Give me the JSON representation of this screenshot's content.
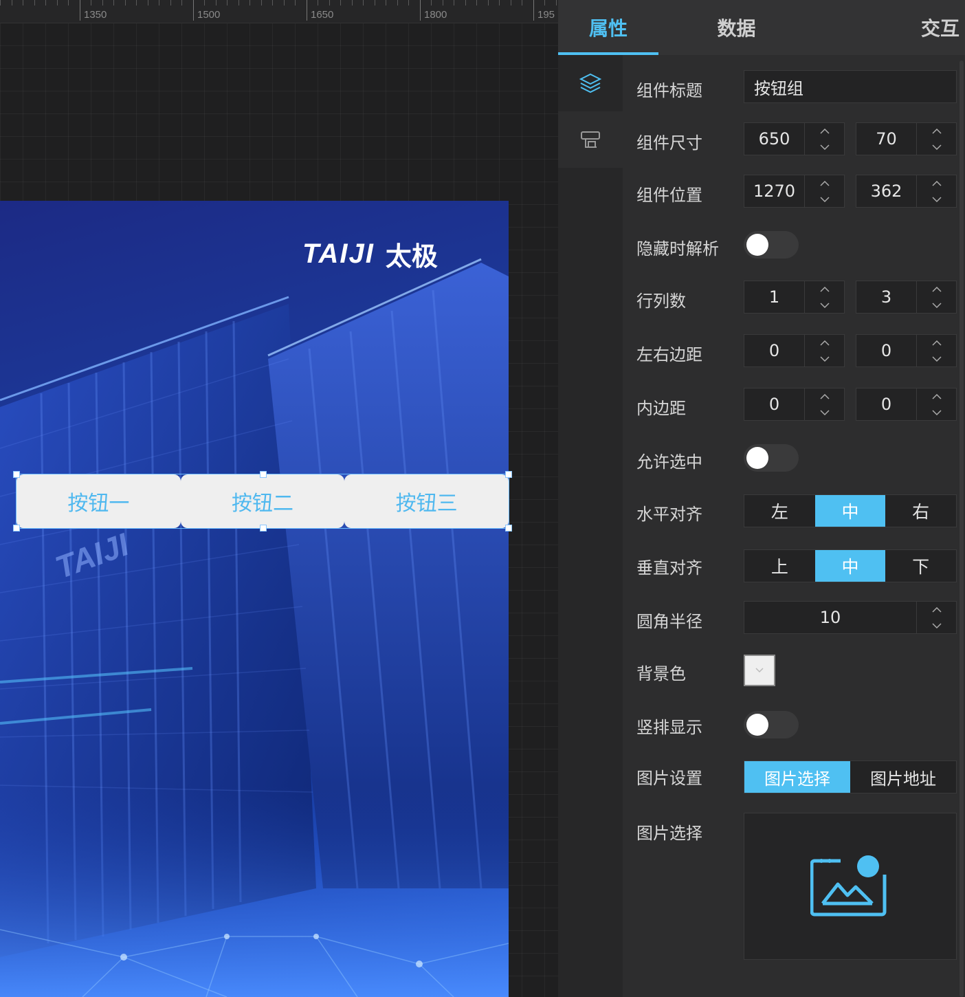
{
  "ruler": {
    "labels": [
      "1350",
      "1500",
      "1650",
      "1800",
      "195"
    ]
  },
  "poster": {
    "brand_latin": "TAIJI",
    "brand_cn": "太极",
    "building_sign": "TAIJI"
  },
  "button_group": {
    "buttons": [
      "按钮一",
      "按钮二",
      "按钮三"
    ],
    "text_color": "#4fb8ef",
    "bg_color": "#efefef"
  },
  "tabs": [
    {
      "label": "属性",
      "active": true
    },
    {
      "label": "数据",
      "active": false
    },
    {
      "label": "交互",
      "active": false
    }
  ],
  "side_rail": {
    "items": [
      "layers-icon",
      "component-icon"
    ]
  },
  "form": {
    "title": {
      "label": "组件标题",
      "value": "按钮组"
    },
    "size": {
      "label": "组件尺寸",
      "width": "650",
      "height": "70"
    },
    "position": {
      "label": "组件位置",
      "x": "1270",
      "y": "362"
    },
    "hidden_parse": {
      "label": "隐藏时解析",
      "on": false
    },
    "grid": {
      "label": "行列数",
      "rows": "1",
      "cols": "3"
    },
    "margin": {
      "label": "左右边距",
      "left": "0",
      "right": "0"
    },
    "padding": {
      "label": "内边距",
      "a": "0",
      "b": "0"
    },
    "allow_select": {
      "label": "允许选中",
      "on": false
    },
    "h_align": {
      "label": "水平对齐",
      "options": [
        "左",
        "中",
        "右"
      ],
      "selected": "中"
    },
    "v_align": {
      "label": "垂直对齐",
      "options": [
        "上",
        "中",
        "下"
      ],
      "selected": "中"
    },
    "radius": {
      "label": "圆角半径",
      "value": "10"
    },
    "bg_color": {
      "label": "背景色",
      "color": "#efefef"
    },
    "vertical": {
      "label": "竖排显示",
      "on": false
    },
    "image_setting": {
      "label": "图片设置",
      "options": [
        "图片选择",
        "图片地址"
      ],
      "selected": "图片选择"
    },
    "image_pick": {
      "label": "图片选择"
    }
  },
  "colors": {
    "accent": "#4fc0f2",
    "panel": "#2d2d2e"
  }
}
